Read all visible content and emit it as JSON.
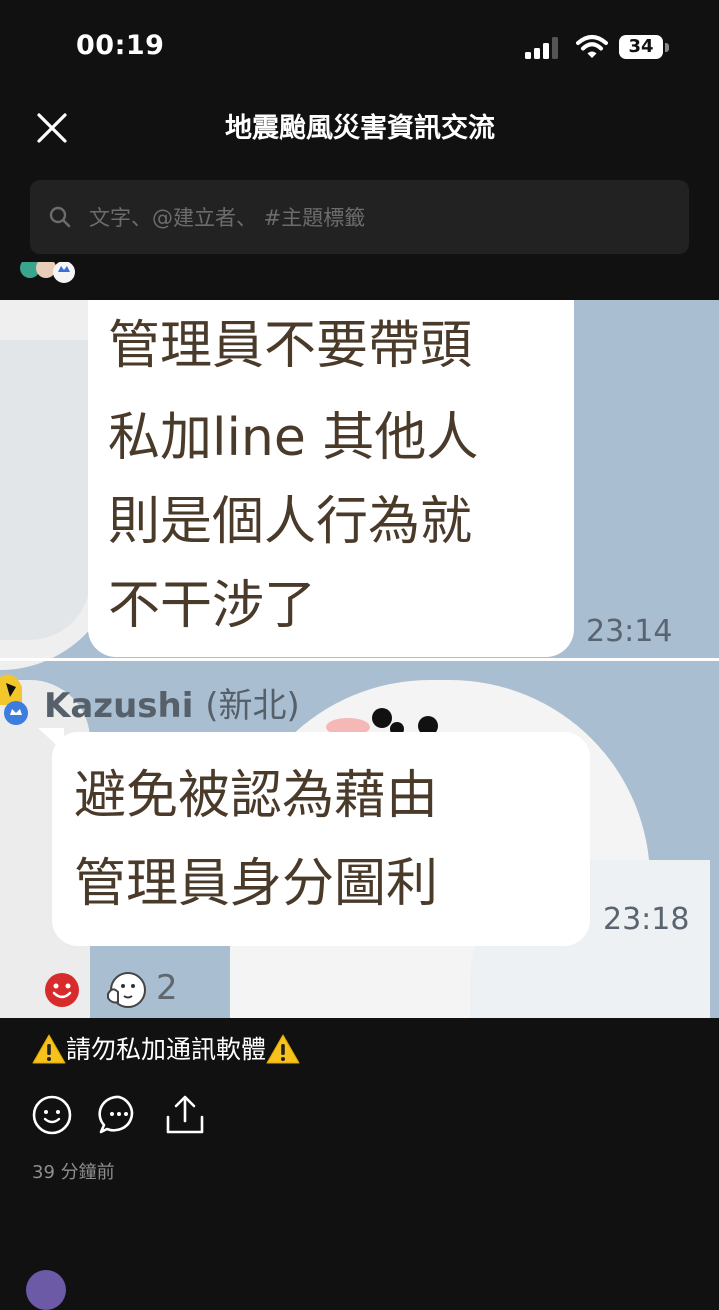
{
  "status_bar": {
    "time": "00:19",
    "battery": "34"
  },
  "header": {
    "title": "地震颱風災害資訊交流"
  },
  "search": {
    "placeholder": "文字、@建立者、 #主題標籤"
  },
  "post_image": {
    "bubble1": {
      "lines": [
        "管理員不要帶頭",
        "私加line 其他人",
        "則是個人行為就",
        "不干涉了"
      ],
      "time": "23:14"
    },
    "bubble2": {
      "sender": "Kazushi",
      "sender_region": "(新北)",
      "lines": [
        "避免被認為藉由",
        "管理員身分圖利"
      ],
      "time": "23:18"
    },
    "reactions": {
      "count": "2"
    }
  },
  "post": {
    "notice_text": "請勿私加通訊軟體",
    "time_ago": "39 分鐘前"
  },
  "icons": {
    "close": "close-icon",
    "search": "search-icon",
    "smile": "smile-icon",
    "comment": "comment-icon",
    "share": "share-icon",
    "warning": "warning-icon"
  }
}
